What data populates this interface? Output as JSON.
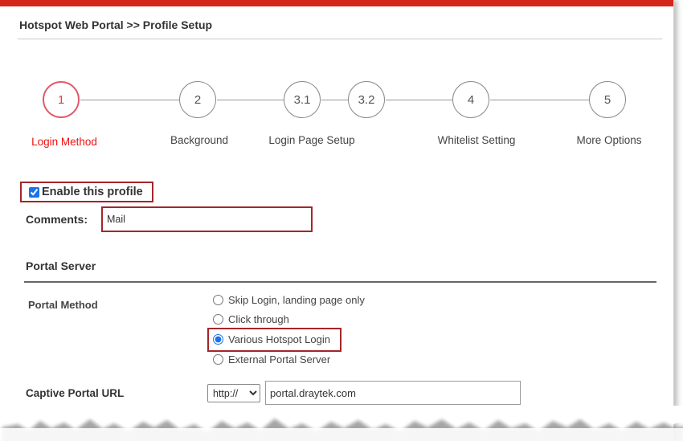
{
  "header": {
    "title": "Hotspot Web Portal >> Profile Setup"
  },
  "steps": [
    {
      "num": "1",
      "label": "Login Method",
      "active": true
    },
    {
      "num": "2",
      "label": "Background",
      "active": false
    },
    {
      "num": "3.1",
      "label": "Login Page Setup",
      "active": false
    },
    {
      "num": "3.2",
      "label": "",
      "active": false
    },
    {
      "num": "4",
      "label": "Whitelist Setting",
      "active": false
    },
    {
      "num": "5",
      "label": "More Options",
      "active": false
    }
  ],
  "profile": {
    "enable_label": "Enable this profile",
    "enabled": true,
    "comments_label": "Comments:",
    "comments_value": "Mail"
  },
  "portal_server": {
    "section_title": "Portal Server",
    "method_label": "Portal Method",
    "methods": [
      {
        "label": "Skip Login, landing page only",
        "selected": false
      },
      {
        "label": "Click through",
        "selected": false
      },
      {
        "label": "Various Hotspot Login",
        "selected": true
      },
      {
        "label": "External Portal Server",
        "selected": false
      }
    ],
    "url_label": "Captive Portal URL",
    "protocol_selected": "http://",
    "url_value": "portal.draytek.com"
  },
  "colors": {
    "accent_red": "#d4261c",
    "highlight_border": "#a3262a",
    "active_step": "#e04050"
  }
}
